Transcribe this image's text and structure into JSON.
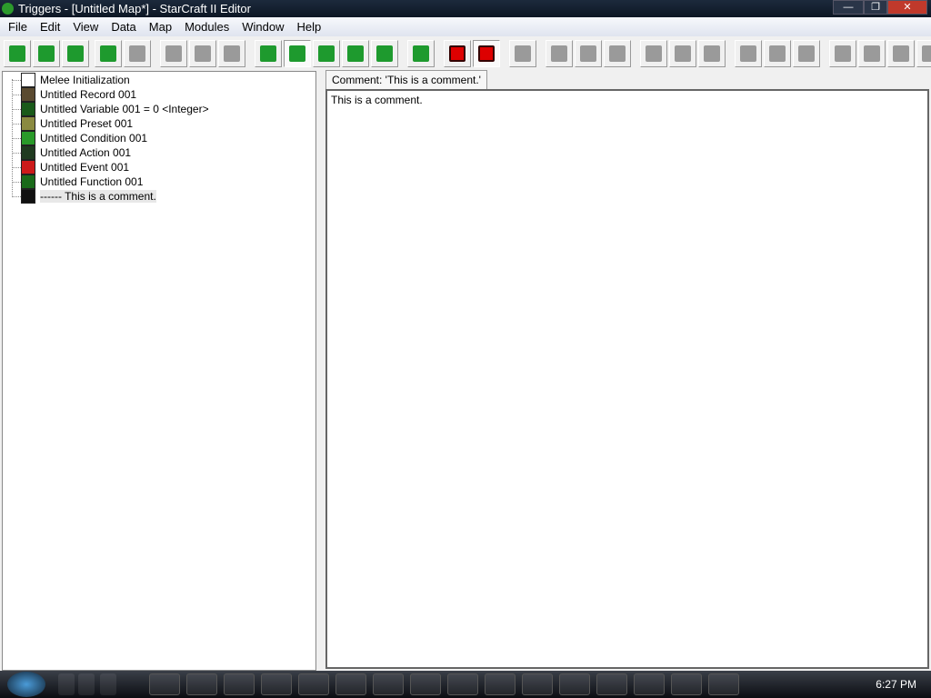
{
  "window": {
    "title": "Triggers - [Untitled Map*] - StarCraft II Editor",
    "controls": [
      "minimize",
      "restore",
      "close"
    ]
  },
  "menu": [
    "File",
    "Edit",
    "View",
    "Data",
    "Map",
    "Modules",
    "Window",
    "Help"
  ],
  "toolbar": [
    {
      "icon": "new-icon",
      "style": "g"
    },
    {
      "icon": "open-icon",
      "style": "g"
    },
    {
      "icon": "save-icon",
      "style": "g"
    },
    {
      "icon": "undo-icon",
      "style": "g"
    },
    {
      "icon": "redo-icon",
      "style": ""
    },
    {
      "icon": "cut-icon",
      "style": ""
    },
    {
      "icon": "copy-icon",
      "style": ""
    },
    {
      "icon": "paste-icon",
      "style": ""
    },
    {
      "icon": "terrain-icon",
      "style": "g"
    },
    {
      "icon": "triggers-icon",
      "style": "g on"
    },
    {
      "icon": "data-icon",
      "style": "g"
    },
    {
      "icon": "text-icon",
      "style": "g"
    },
    {
      "icon": "import-icon",
      "style": "g"
    },
    {
      "icon": "units-icon",
      "style": "g"
    },
    {
      "icon": "stop-icon",
      "style": "r"
    },
    {
      "icon": "stop-icon",
      "style": "r on"
    },
    {
      "icon": "new-trigger-icon",
      "style": ""
    },
    {
      "icon": "folder-icon",
      "style": ""
    },
    {
      "icon": "button-icon",
      "style": ""
    },
    {
      "icon": "button-icon",
      "style": ""
    },
    {
      "icon": "event-icon",
      "style": ""
    },
    {
      "icon": "action-icon",
      "style": ""
    },
    {
      "icon": "condition-icon",
      "style": ""
    },
    {
      "icon": "document-icon",
      "style": ""
    },
    {
      "icon": "edit-icon",
      "style": ""
    },
    {
      "icon": "button-icon",
      "style": ""
    },
    {
      "icon": "button-icon",
      "style": ""
    },
    {
      "icon": "button-icon",
      "style": ""
    },
    {
      "icon": "button-icon",
      "style": ""
    },
    {
      "icon": "button-icon",
      "style": ""
    }
  ],
  "tree": [
    {
      "label": "Melee Initialization",
      "icon": "document-icon",
      "color": "#ffffff"
    },
    {
      "label": "Untitled Record 001",
      "icon": "record-icon",
      "color": "#5a4a30"
    },
    {
      "label": "Untitled Variable 001 = 0 <Integer>",
      "icon": "variable-icon",
      "color": "#1a5a1a"
    },
    {
      "label": "Untitled Preset 001",
      "icon": "preset-icon",
      "color": "#8a8a40"
    },
    {
      "label": "Untitled Condition 001",
      "icon": "condition-icon",
      "color": "#2a9a2a"
    },
    {
      "label": "Untitled Action 001",
      "icon": "action-icon",
      "color": "#203a20"
    },
    {
      "label": "Untitled Event 001",
      "icon": "event-flag-icon",
      "color": "#cc1a1a"
    },
    {
      "label": "Untitled Function 001",
      "icon": "function-icon",
      "color": "#1a6a1a"
    },
    {
      "label": "------ This is a comment.",
      "icon": "comment-icon",
      "color": "#111111"
    }
  ],
  "editor": {
    "tab": "Comment: 'This is a comment.'",
    "text": "This is a comment."
  },
  "taskbar": {
    "clock": "6:27 PM",
    "apps": [
      "word",
      "internet-explorer",
      "winrar",
      "firefox",
      "audition",
      "vimeo",
      "folder",
      "app",
      "starcraft-globe",
      "remote",
      "quicktime",
      "media",
      "mcafee",
      "installer",
      "starcraft-ii-editor",
      "app"
    ]
  }
}
